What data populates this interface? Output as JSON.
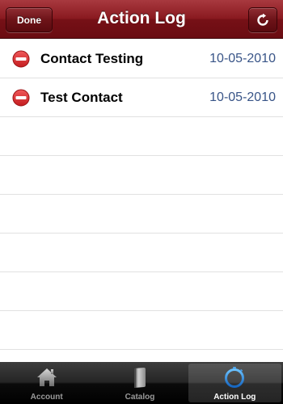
{
  "navbar": {
    "title": "Action Log",
    "done_label": "Done",
    "refresh_icon": "refresh-icon"
  },
  "list": {
    "rows": [
      {
        "title": "Contact Testing",
        "date": "10-05-2010"
      },
      {
        "title": "Test Contact",
        "date": "10-05-2010"
      }
    ],
    "delete_icon": "minus-circle-icon",
    "delete_color": "#d12a2a",
    "date_color": "#385487"
  },
  "tabbar": {
    "tabs": [
      {
        "label": "Account",
        "icon": "home-icon",
        "active": false
      },
      {
        "label": "Catalog",
        "icon": "book-icon",
        "active": false
      },
      {
        "label": "Action Log",
        "icon": "stopwatch-icon",
        "active": true
      }
    ]
  },
  "colors": {
    "navbar": "#7a1217",
    "tabbar": "#1a1a1a",
    "active_tab_icon": "#1e88e5"
  }
}
